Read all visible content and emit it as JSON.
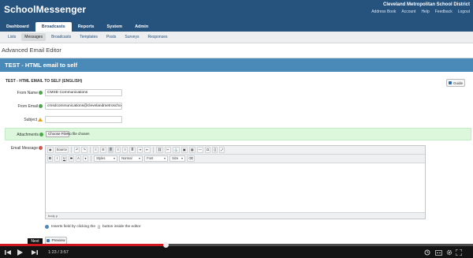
{
  "app": {
    "brand": "SchoolMessenger",
    "district": "Cleveland Metropolitan School District",
    "top_links": [
      "Address Book",
      "Account",
      "Help",
      "Feedback",
      "Logout"
    ]
  },
  "main_nav": {
    "tabs": [
      "Dashboard",
      "Broadcasts",
      "Reports",
      "System",
      "Admin"
    ],
    "active": "Broadcasts"
  },
  "sub_nav": {
    "items": [
      "Lists",
      "Messages",
      "Broadcasts",
      "Templates",
      "Posts",
      "Surveys",
      "Responses"
    ],
    "active": "Messages"
  },
  "page": {
    "title": "Advanced Email Editor",
    "panel_title": "TEST - HTML email to self",
    "section_title": "TEST - HTML EMAIL TO SELF (ENGLISH)",
    "guide_label": "Guide"
  },
  "form": {
    "from_name_label": "From Name",
    "from_name_value": "CMSD Communications",
    "from_email_label": "From Email",
    "from_email_value": "cmsdcommunications@clevelandmetroschools.org",
    "subject_label": "Subject",
    "subject_value": "",
    "attachments_label": "Attachments",
    "choose_file_label": "Choose File",
    "no_file_text": "No file chosen",
    "email_message_label": "Email Message"
  },
  "editor": {
    "toolbar1": [
      "Source",
      "Undo",
      "Redo",
      "Ordered list",
      "Bullet list",
      "Align left",
      "Align center",
      "Align right",
      "Justify",
      "Link",
      "Unlink",
      "Anchor",
      "Image",
      "Table",
      "Horizontal line",
      "Special char",
      "Page break",
      "Iframe",
      "Field insert",
      "Maximize"
    ],
    "source_label": "Source",
    "bold": "B",
    "italic": "I",
    "underline": "U",
    "strike": "S",
    "text_color": "A",
    "styles_label": "Styles",
    "format_label": "Normal",
    "font_label": "Font",
    "size_label": "Size",
    "status_text": "body  p"
  },
  "hint": {
    "text": "Inserts field by clicking the",
    "text_after": "button inside the editor"
  },
  "preview_label": "Preview",
  "video_player": {
    "next_tip": "Next",
    "time": "1:23 / 3:57",
    "progress_fraction": 0.352
  }
}
